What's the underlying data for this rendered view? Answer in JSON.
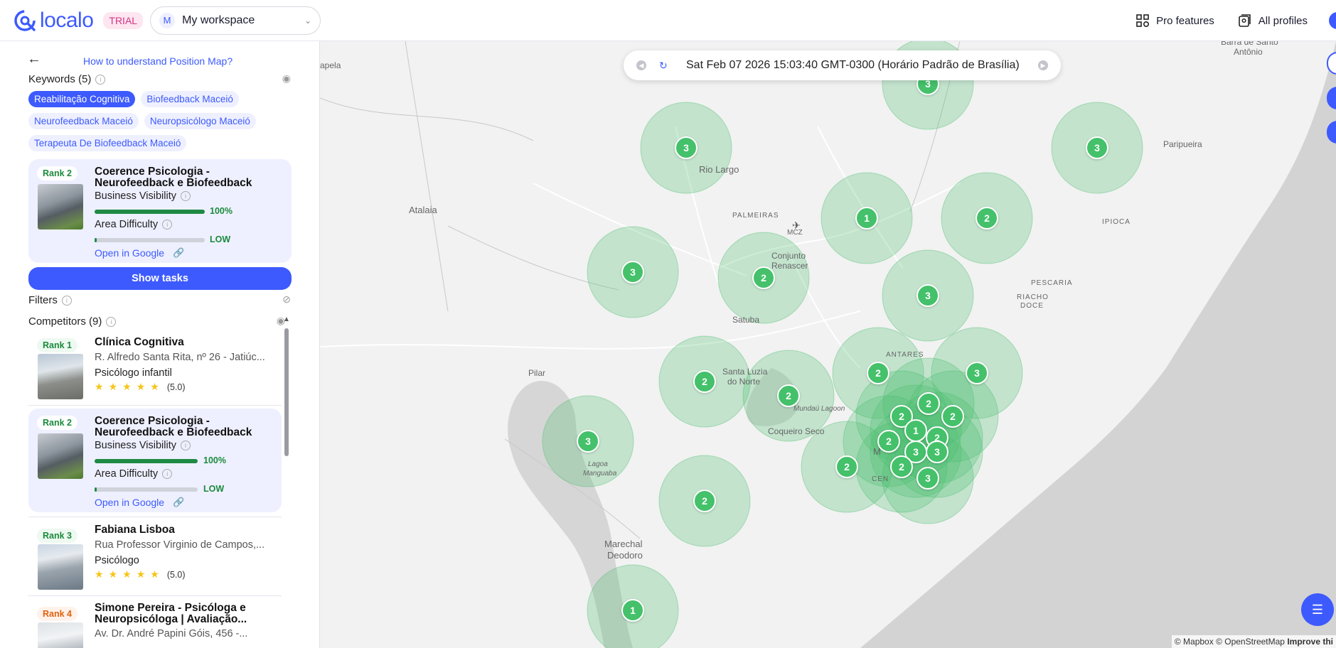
{
  "header": {
    "logo_text": "localo",
    "trial_badge": "TRIAL",
    "workspace": {
      "avatar": "M",
      "name": "My workspace"
    },
    "pro_features": "Pro features",
    "all_profiles": "All profiles"
  },
  "sidebar": {
    "help_link": "How to understand Position Map?",
    "keywords_title": "Keywords (5)",
    "keywords": [
      "Reabilitação Cognitiva",
      "Biofeedback Maceió",
      "Neurofeedback Maceió",
      "Neuropsicólogo Maceió",
      "Terapeuta De Biofeedback Maceió"
    ],
    "own": {
      "rank": "Rank 2",
      "name": "Coerence Psicologia - Neurofeedback e Biofeedback",
      "visibility_label": "Business Visibility",
      "visibility_value": "100%",
      "visibility_fraction": 1.0,
      "difficulty_label": "Area Difficulty",
      "difficulty_value": "LOW",
      "difficulty_fraction": 0.02,
      "open_google": "Open in Google"
    },
    "show_tasks": "Show tasks",
    "filters_title": "Filters",
    "competitors_title": "Competitors (9)",
    "competitors": [
      {
        "rank": "Rank 1",
        "name": "Clínica Cognitiva",
        "address": "R. Alfredo Santa Rita, nº 26 - Jatiúc...",
        "category": "Psicólogo infantil",
        "rating": "(5.0)"
      },
      {
        "rank": "Rank 2",
        "name": "Coerence Psicologia - Neurofeedback e Biofeedback",
        "visibility_label": "Business Visibility",
        "visibility_value": "100%",
        "difficulty_label": "Area Difficulty",
        "difficulty_value": "LOW",
        "open_google": "Open in Google"
      },
      {
        "rank": "Rank 3",
        "name": "Fabiana Lisboa",
        "address": "Rua Professor Virginio de Campos,...",
        "category": "Psicólogo",
        "rating": "(5.0)"
      },
      {
        "rank": "Rank 4",
        "name": "Simone Pereira - Psicóloga e Neuropsicóloga | Avaliação...",
        "address": "Av. Dr. André Papini Góis, 456 -..."
      }
    ]
  },
  "map": {
    "datetime": "Sat Feb 07 2026 15:03:40 GMT-0300 (Horário Padrão de Brasília)",
    "attribution_1": "© Mapbox",
    "attribution_2": "© OpenStreetMap",
    "attribution_3": "Improve thi",
    "places": [
      "Barra de Santo",
      "Antônio",
      "Paripueira",
      "Rio Largo",
      "Atalaia",
      "PALMEIRAS",
      "MCZ",
      "Conjunto",
      "Renascer",
      "IPIOCA",
      "PESCARIA",
      "RIACHO",
      "DOCE",
      "Satuba",
      "Pilar",
      "Santa Luzia",
      "do Norte",
      "ANTARES",
      "Mundaú Lagoon",
      "Coqueiro Seco",
      "Lagoa",
      "Manguaba",
      "Marechal",
      "Deodoro",
      "apela",
      "M",
      "CEN"
    ],
    "markers": [
      "3",
      "3",
      "3",
      "1",
      "2",
      "3",
      "2",
      "3",
      "2",
      "2",
      "2",
      "3",
      "3",
      "2",
      "2",
      "1",
      "2",
      "2",
      "2",
      "1",
      "2",
      "2",
      "3",
      "3",
      "2",
      "3"
    ]
  }
}
